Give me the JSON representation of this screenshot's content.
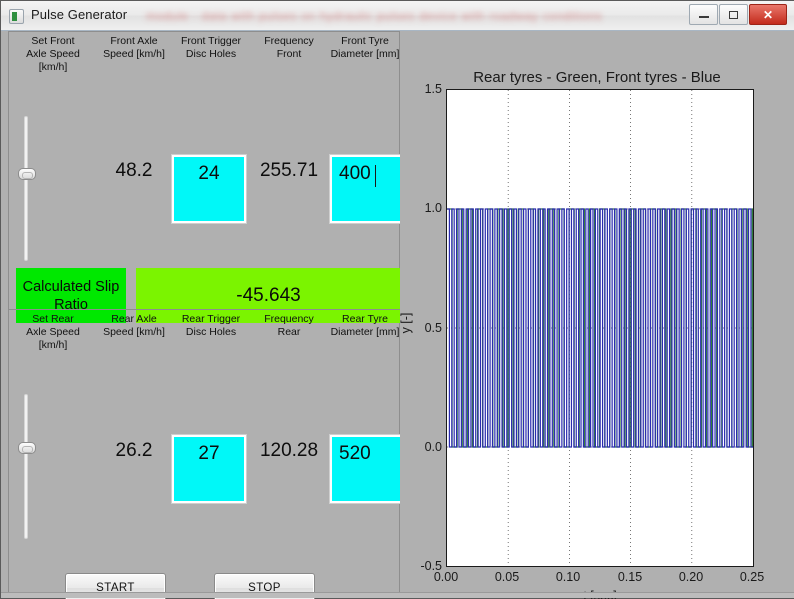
{
  "window": {
    "title": "Pulse Generator",
    "redacted_title_suffix": "module - data with pulses on hydraulic pulses device with roadway conditions",
    "icon": "app-icon",
    "buttons": {
      "minimize": "minimize-icon",
      "maximize": "maximize-icon",
      "close": "✕"
    }
  },
  "front_section": {
    "headers": [
      "Set Front\nAxle Speed\n[km/h]",
      "Front Axle\nSpeed [km/h]",
      "Front Trigger\nDisc Holes",
      "Frequency\nFront",
      "Front Tyre\nDiameter [mm]"
    ],
    "set_speed_slider_label": "set-front-axle-speed-slider",
    "axle_speed": "48.2",
    "trigger_disc_holes": "24",
    "frequency": "255.71",
    "tyre_diameter": "400"
  },
  "slip": {
    "label": "Calculated Slip Ratio",
    "value": "-45.643",
    "label_color": "#00e800",
    "value_color": "#7bf400"
  },
  "rear_section": {
    "headers": [
      "Set Rear\nAxle Speed\n[km/h]",
      "Rear Axle\nSpeed [km/h]",
      "Rear Trigger\nDisc Holes",
      "Frequency\nRear",
      "Rear Tyre\nDiameter [mm]"
    ],
    "set_speed_slider_label": "set-rear-axle-speed-slider",
    "axle_speed": "26.2",
    "trigger_disc_holes": "27",
    "frequency": "120.28",
    "tyre_diameter": "520"
  },
  "actions": {
    "start": "START",
    "stop": "STOP"
  },
  "colors": {
    "input_cyan": "#00f8f8",
    "panel_gray": "#b0b0b0",
    "front_trace": "#2b2bb0",
    "rear_trace": "#2f7d3a"
  },
  "chart_data": {
    "type": "line",
    "title": "Rear tyres - Green, Front tyres - Blue",
    "xlabel": "t [sec]",
    "ylabel": "y [-]",
    "xlim": [
      0.0,
      0.25
    ],
    "ylim": [
      -0.5,
      1.5
    ],
    "xticks": [
      "0.00",
      "0.05",
      "0.10",
      "0.15",
      "0.20",
      "0.25"
    ],
    "yticks": [
      "1.5",
      "1.0",
      "0.5",
      "0.0",
      "-0.5"
    ],
    "grid": true,
    "legend_position": "title",
    "series": [
      {
        "name": "Front tyres - Blue",
        "color": "#2b2bb0",
        "waveform": "square",
        "frequency_hz": 255.71,
        "amplitude": 1.0,
        "duty_cycle": 0.5,
        "low": 0.0,
        "high": 1.0
      },
      {
        "name": "Rear tyres - Green",
        "color": "#2f7d3a",
        "waveform": "square",
        "frequency_hz": 120.28,
        "amplitude": 1.0,
        "duty_cycle": 0.5,
        "low": 0.0,
        "high": 1.0
      }
    ]
  }
}
